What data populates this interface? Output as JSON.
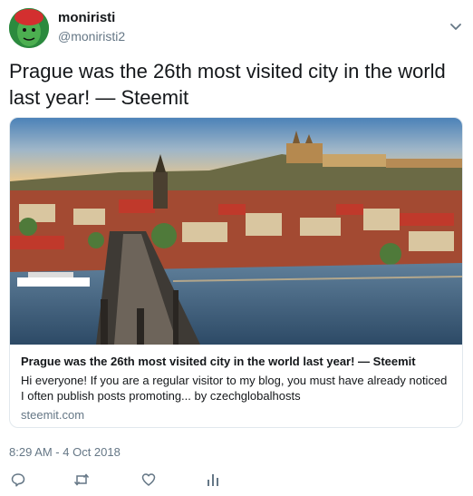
{
  "user": {
    "display_name": "moniristi",
    "handle": "@moniristi2"
  },
  "tweet": {
    "text": "Prague was the 26th most visited city in the world last year! — Steemit",
    "timestamp": "8:29 AM - 4 Oct 2018"
  },
  "card": {
    "title": "Prague was the 26th most visited city in the world last year! — Steemit",
    "description": "Hi everyone! If you are a regular visitor to my blog, you must have already noticed I often publish posts promoting... by czechglobalhosts",
    "domain": "steemit.com"
  },
  "actions": [
    {
      "icon": "reply-icon"
    },
    {
      "icon": "retweet-icon"
    },
    {
      "icon": "like-icon"
    },
    {
      "icon": "analytics-icon"
    }
  ],
  "colors": {
    "text": "#14171a",
    "secondary": "#657786",
    "border": "#e1e8ed",
    "icon": "#657786"
  }
}
